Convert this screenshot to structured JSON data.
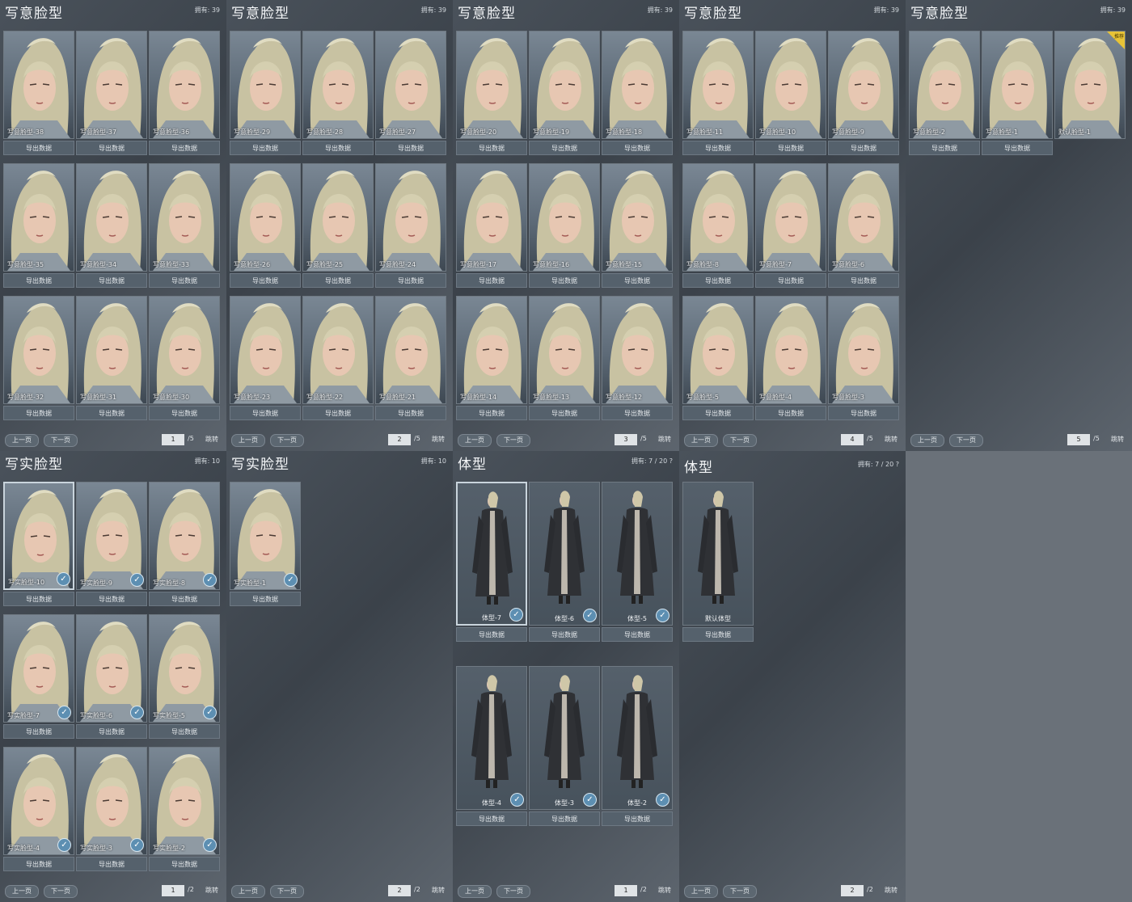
{
  "panels": [
    {
      "title": "写意脸型",
      "owned": "拥有: 39",
      "page": "1",
      "total": "/5",
      "prev": "上一页",
      "next": "下一页",
      "jump": "跳转",
      "cards": [
        {
          "label": "写意脸型-38",
          "export": "导出数据"
        },
        {
          "label": "写意脸型-37",
          "export": "导出数据"
        },
        {
          "label": "写意脸型-36",
          "export": "导出数据"
        },
        {
          "label": "写意脸型-35",
          "export": "导出数据"
        },
        {
          "label": "写意脸型-34",
          "export": "导出数据"
        },
        {
          "label": "写意脸型-33",
          "export": "导出数据"
        },
        {
          "label": "写意脸型-32",
          "export": "导出数据"
        },
        {
          "label": "写意脸型-31",
          "export": "导出数据"
        },
        {
          "label": "写意脸型-30",
          "export": "导出数据"
        }
      ]
    },
    {
      "title": "写意脸型",
      "owned": "拥有: 39",
      "page": "2",
      "total": "/5",
      "prev": "上一页",
      "next": "下一页",
      "jump": "跳转",
      "cards": [
        {
          "label": "写意脸型-29",
          "export": "导出数据"
        },
        {
          "label": "写意脸型-28",
          "export": "导出数据"
        },
        {
          "label": "写意脸型-27",
          "export": "导出数据"
        },
        {
          "label": "写意脸型-26",
          "export": "导出数据"
        },
        {
          "label": "写意脸型-25",
          "export": "导出数据"
        },
        {
          "label": "写意脸型-24",
          "export": "导出数据"
        },
        {
          "label": "写意脸型-23",
          "export": "导出数据"
        },
        {
          "label": "写意脸型-22",
          "export": "导出数据"
        },
        {
          "label": "写意脸型-21",
          "export": "导出数据"
        }
      ]
    },
    {
      "title": "写意脸型",
      "owned": "拥有: 39",
      "page": "3",
      "total": "/5",
      "prev": "上一页",
      "next": "下一页",
      "jump": "跳转",
      "cards": [
        {
          "label": "写意脸型-20",
          "export": "导出数据"
        },
        {
          "label": "写意脸型-19",
          "export": "导出数据"
        },
        {
          "label": "写意脸型-18",
          "export": "导出数据"
        },
        {
          "label": "写意脸型-17",
          "export": "导出数据"
        },
        {
          "label": "写意脸型-16",
          "export": "导出数据"
        },
        {
          "label": "写意脸型-15",
          "export": "导出数据"
        },
        {
          "label": "写意脸型-14",
          "export": "导出数据"
        },
        {
          "label": "写意脸型-13",
          "export": "导出数据"
        },
        {
          "label": "写意脸型-12",
          "export": "导出数据"
        }
      ]
    },
    {
      "title": "写意脸型",
      "owned": "拥有: 39",
      "page": "4",
      "total": "/5",
      "prev": "上一页",
      "next": "下一页",
      "jump": "跳转",
      "cards": [
        {
          "label": "写意脸型-11",
          "export": "导出数据"
        },
        {
          "label": "写意脸型-10",
          "export": "导出数据"
        },
        {
          "label": "写意脸型-9",
          "export": "导出数据"
        },
        {
          "label": "写意脸型-8",
          "export": "导出数据"
        },
        {
          "label": "写意脸型-7",
          "export": "导出数据"
        },
        {
          "label": "写意脸型-6",
          "export": "导出数据"
        },
        {
          "label": "写意脸型-5",
          "export": "导出数据"
        },
        {
          "label": "写意脸型-4",
          "export": "导出数据"
        },
        {
          "label": "写意脸型-3",
          "export": "导出数据"
        }
      ]
    },
    {
      "title": "写意脸型",
      "owned": "拥有: 39",
      "page": "5",
      "total": "/5",
      "prev": "上一页",
      "next": "下一页",
      "jump": "跳转",
      "badge": "推荐",
      "cards": [
        {
          "label": "写意脸型-2",
          "export": "导出数据"
        },
        {
          "label": "写意脸型-1",
          "export": "导出数据"
        },
        {
          "label": "默认脸型-1",
          "export": ""
        }
      ]
    },
    {
      "title": "写实脸型",
      "owned": "拥有: 10",
      "page": "1",
      "total": "/2",
      "prev": "上一页",
      "next": "下一页",
      "jump": "跳转",
      "cards": [
        {
          "label": "写实脸型-10",
          "export": "导出数据"
        },
        {
          "label": "写实脸型-9",
          "export": "导出数据"
        },
        {
          "label": "写实脸型-8",
          "export": "导出数据"
        },
        {
          "label": "写实脸型-7",
          "export": "导出数据"
        },
        {
          "label": "写实脸型-6",
          "export": "导出数据"
        },
        {
          "label": "写实脸型-5",
          "export": "导出数据"
        },
        {
          "label": "写实脸型-4",
          "export": "导出数据"
        },
        {
          "label": "写实脸型-3",
          "export": "导出数据"
        },
        {
          "label": "写实脸型-2",
          "export": "导出数据"
        }
      ]
    },
    {
      "title": "写实脸型",
      "owned": "拥有: 10",
      "page": "2",
      "total": "/2",
      "prev": "上一页",
      "next": "下一页",
      "jump": "跳转",
      "cards": [
        {
          "label": "写实脸型-1",
          "export": "导出数据"
        }
      ]
    },
    {
      "title": "体型",
      "owned": "拥有: 7 / 20",
      "help": "?",
      "page": "1",
      "total": "/2",
      "prev": "上一页",
      "next": "下一页",
      "jump": "跳转",
      "cards": [
        {
          "label": "体型-7",
          "export": "导出数据"
        },
        {
          "label": "体型-6",
          "export": "导出数据"
        },
        {
          "label": "体型-5",
          "export": "导出数据"
        },
        {
          "label": "体型-4",
          "export": "导出数据"
        },
        {
          "label": "体型-3",
          "export": "导出数据"
        },
        {
          "label": "体型-2",
          "export": "导出数据"
        }
      ]
    },
    {
      "title": "体型",
      "owned": "拥有: 7 / 20",
      "help": "?",
      "page": "2",
      "total": "/2",
      "prev": "上一页",
      "next": "下一页",
      "jump": "跳转",
      "cards": [
        {
          "label": "默认体型",
          "export": "导出数据"
        }
      ]
    }
  ],
  "colors": {
    "panel_bg": "#424a52",
    "accent_check": "#5d8fb2",
    "badge": "#e8c337"
  }
}
